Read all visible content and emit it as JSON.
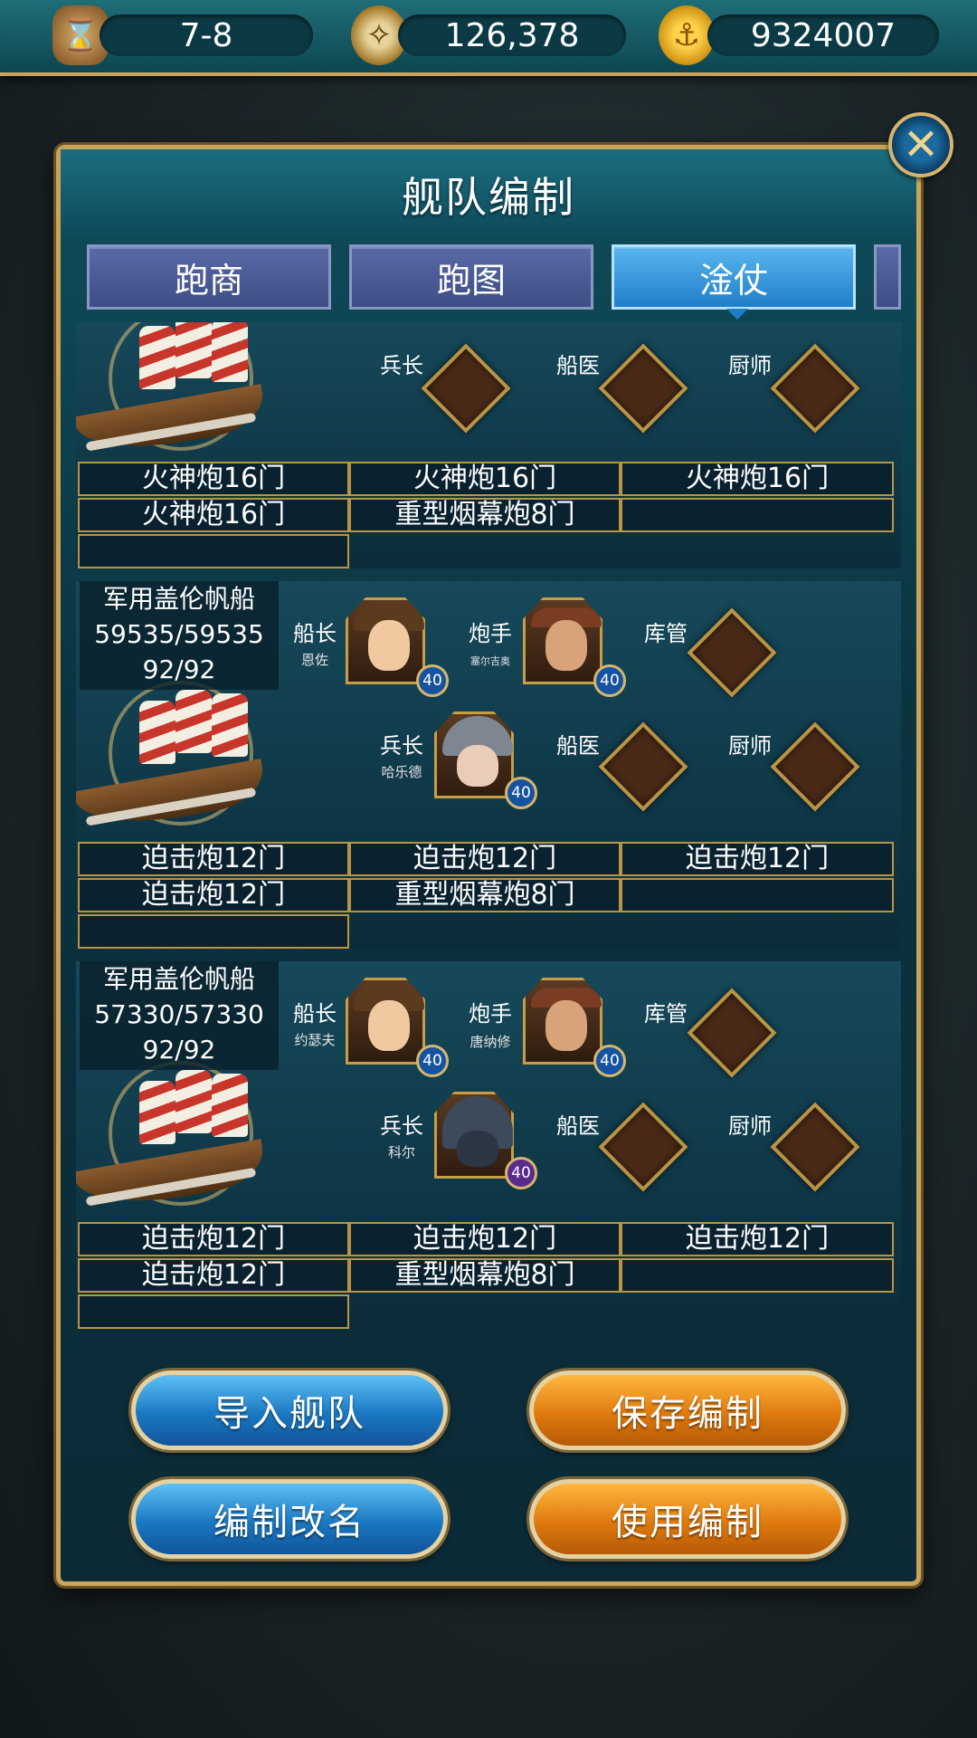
{
  "resources": {
    "stage": "7-8",
    "exploration": "126,378",
    "gold": "9324007"
  },
  "dialog": {
    "title": "舰队编制",
    "close_icon": "close-x-icon",
    "tabs": [
      {
        "label": "跑商",
        "active": false
      },
      {
        "label": "跑图",
        "active": false
      },
      {
        "label": "淦仗",
        "active": true
      }
    ]
  },
  "ships": [
    {
      "info": null,
      "roles": {
        "bingzhang": {
          "label": "兵长",
          "name": ""
        },
        "chuanyi": {
          "label": "船医"
        },
        "chushi": {
          "label": "厨师"
        }
      },
      "cannons": [
        "火神炮16门",
        "火神炮16门",
        "火神炮16门",
        "火神炮16门",
        "重型烟幕炮8门",
        "",
        ""
      ]
    },
    {
      "info": {
        "name": "军用盖伦帆船",
        "hp": "59535/59535",
        "crew": "92/92"
      },
      "roles": {
        "chuanzhang": {
          "label": "船长",
          "name": "恩佐",
          "level": "40"
        },
        "paoshou": {
          "label": "炮手",
          "name": "塞尔吉奥",
          "level": "40"
        },
        "kuguan": {
          "label": "库管"
        },
        "bingzhang": {
          "label": "兵长",
          "name": "哈乐德",
          "level": "40"
        },
        "chuanyi": {
          "label": "船医"
        },
        "chushi": {
          "label": "厨师"
        }
      },
      "cannons": [
        "迫击炮12门",
        "迫击炮12门",
        "迫击炮12门",
        "迫击炮12门",
        "重型烟幕炮8门",
        "",
        ""
      ]
    },
    {
      "info": {
        "name": "军用盖伦帆船",
        "hp": "57330/57330",
        "crew": "92/92"
      },
      "roles": {
        "chuanzhang": {
          "label": "船长",
          "name": "约瑟夫",
          "level": "40"
        },
        "paoshou": {
          "label": "炮手",
          "name": "唐纳修",
          "level": "40"
        },
        "kuguan": {
          "label": "库管"
        },
        "bingzhang": {
          "label": "兵长",
          "name": "科尔",
          "level": "40"
        },
        "chuanyi": {
          "label": "船医"
        },
        "chushi": {
          "label": "厨师"
        }
      },
      "cannons": [
        "迫击炮12门",
        "迫击炮12门",
        "迫击炮12门",
        "迫击炮12门",
        "重型烟幕炮8门",
        "",
        ""
      ]
    }
  ],
  "buttons": {
    "import": "导入舰队",
    "save": "保存编制",
    "rename": "编制改名",
    "use": "使用编制"
  }
}
